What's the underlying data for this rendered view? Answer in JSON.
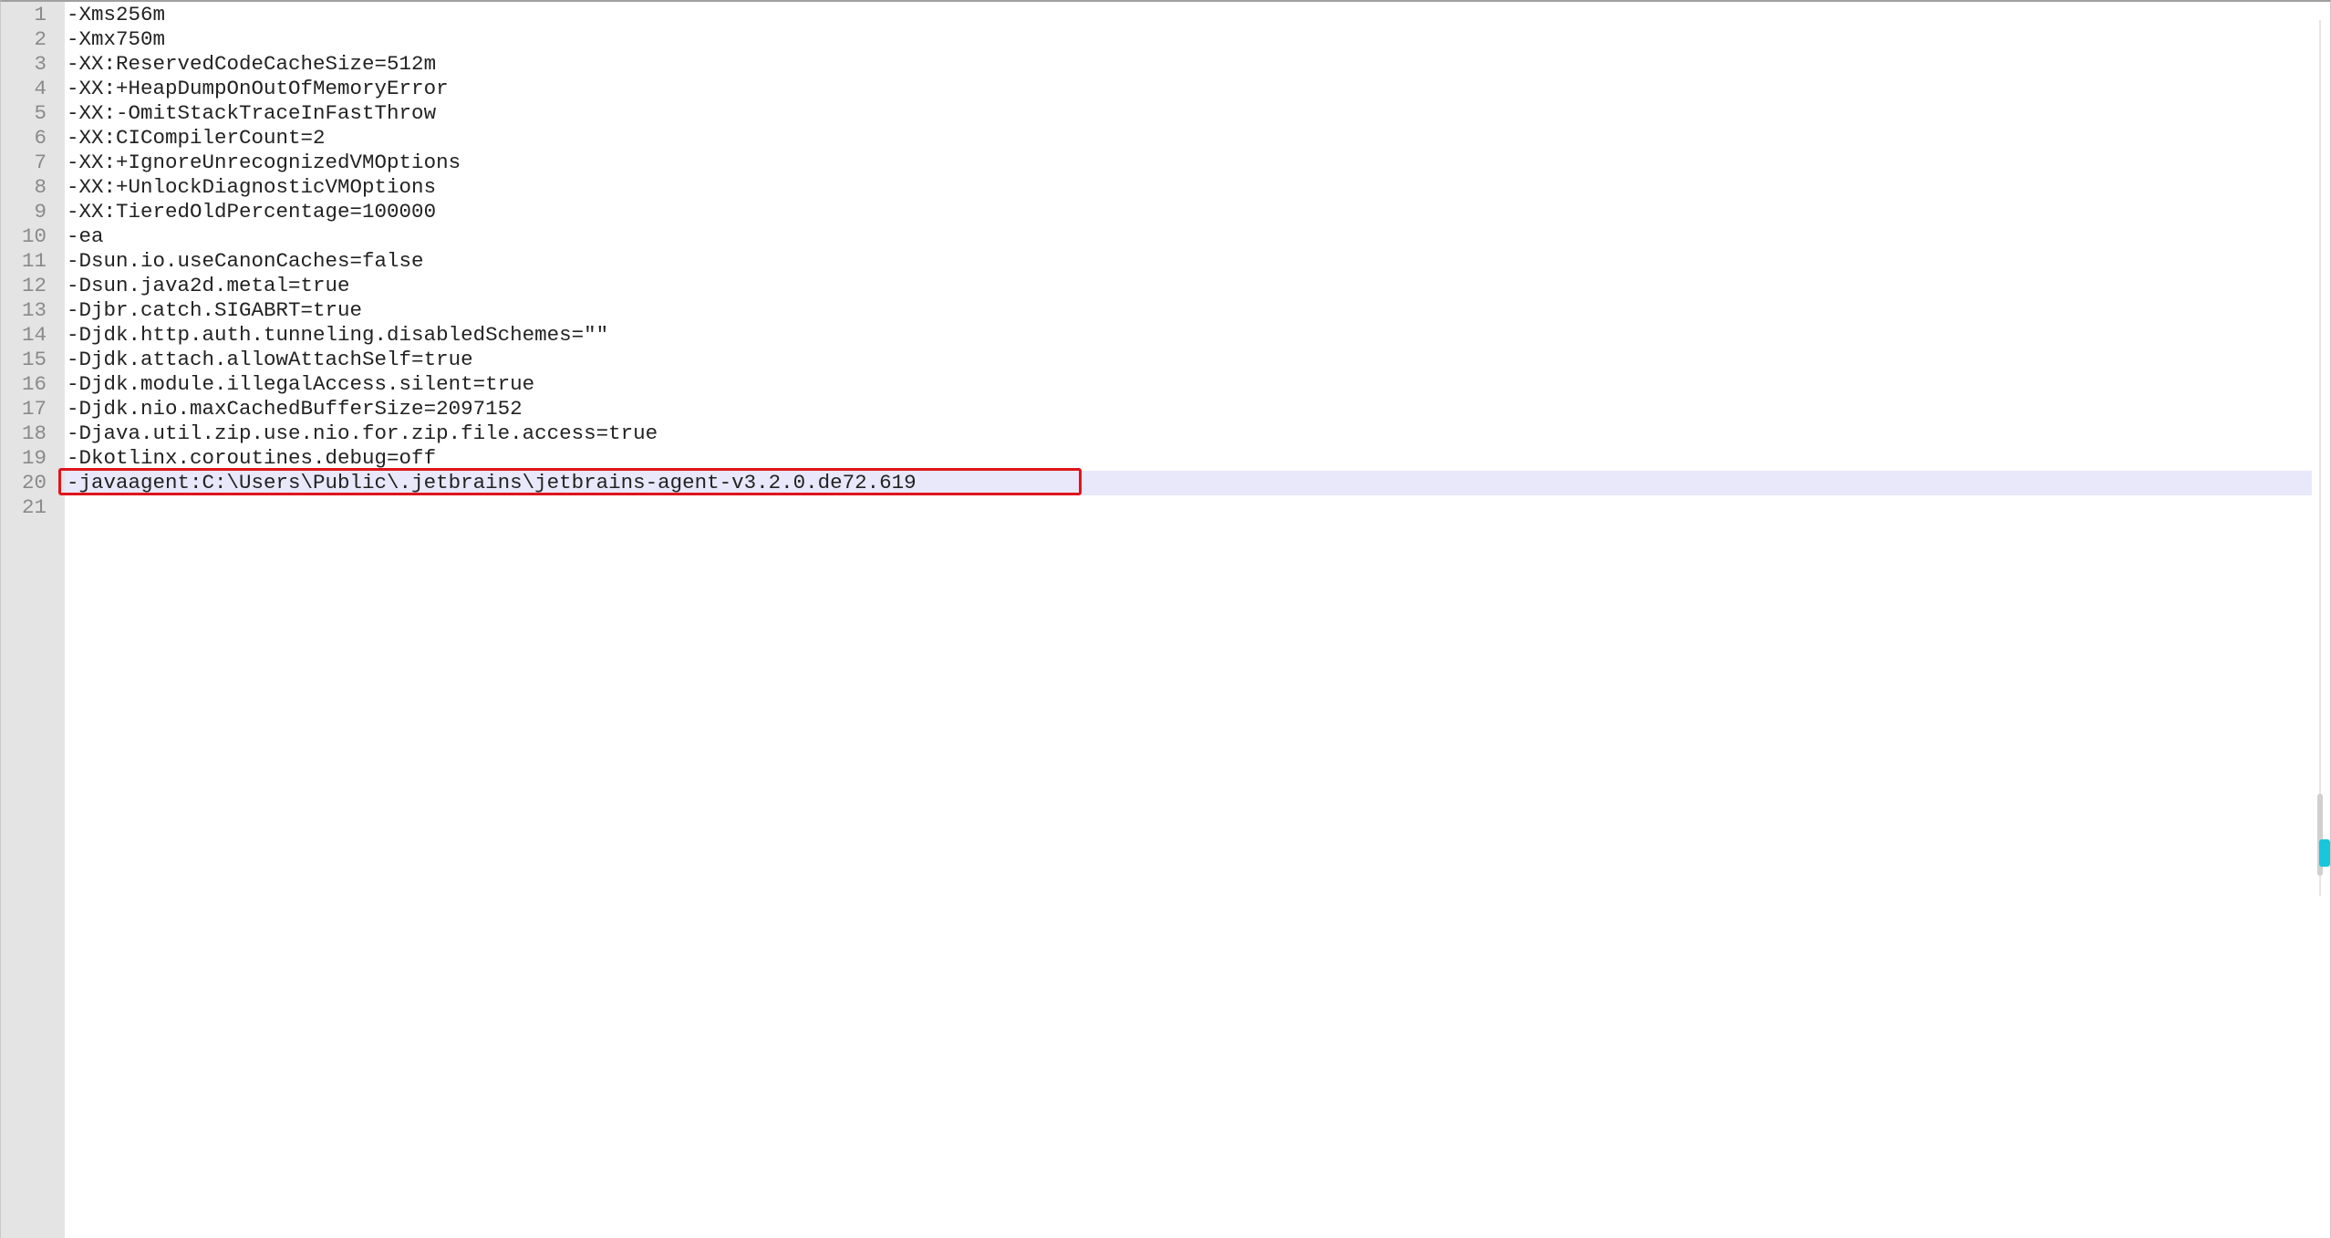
{
  "editor": {
    "current_line": 20,
    "highlighted_line": 20,
    "lines": [
      {
        "num": "1",
        "text": "-Xms256m"
      },
      {
        "num": "2",
        "text": "-Xmx750m"
      },
      {
        "num": "3",
        "text": "-XX:ReservedCodeCacheSize=512m"
      },
      {
        "num": "4",
        "text": "-XX:+HeapDumpOnOutOfMemoryError"
      },
      {
        "num": "5",
        "text": "-XX:-OmitStackTraceInFastThrow"
      },
      {
        "num": "6",
        "text": "-XX:CICompilerCount=2"
      },
      {
        "num": "7",
        "text": "-XX:+IgnoreUnrecognizedVMOptions"
      },
      {
        "num": "8",
        "text": "-XX:+UnlockDiagnosticVMOptions"
      },
      {
        "num": "9",
        "text": "-XX:TieredOldPercentage=100000"
      },
      {
        "num": "10",
        "text": "-ea"
      },
      {
        "num": "11",
        "text": "-Dsun.io.useCanonCaches=false"
      },
      {
        "num": "12",
        "text": "-Dsun.java2d.metal=true"
      },
      {
        "num": "13",
        "text": "-Djbr.catch.SIGABRT=true"
      },
      {
        "num": "14",
        "text": "-Djdk.http.auth.tunneling.disabledSchemes=\"\""
      },
      {
        "num": "15",
        "text": "-Djdk.attach.allowAttachSelf=true"
      },
      {
        "num": "16",
        "text": "-Djdk.module.illegalAccess.silent=true"
      },
      {
        "num": "17",
        "text": "-Djdk.nio.maxCachedBufferSize=2097152"
      },
      {
        "num": "18",
        "text": "-Djava.util.zip.use.nio.for.zip.file.access=true"
      },
      {
        "num": "19",
        "text": "-Dkotlinx.coroutines.debug=off"
      },
      {
        "num": "20",
        "text": "-javaagent:C:\\Users\\Public\\.jetbrains\\jetbrains-agent-v3.2.0.de72.619"
      },
      {
        "num": "21",
        "text": ""
      }
    ]
  },
  "colors": {
    "gutter_bg": "#e4e4e4",
    "current_line_bg": "#e8e8fa",
    "highlight_border": "#e0141c",
    "scroll_marker": "#19c6dc"
  }
}
